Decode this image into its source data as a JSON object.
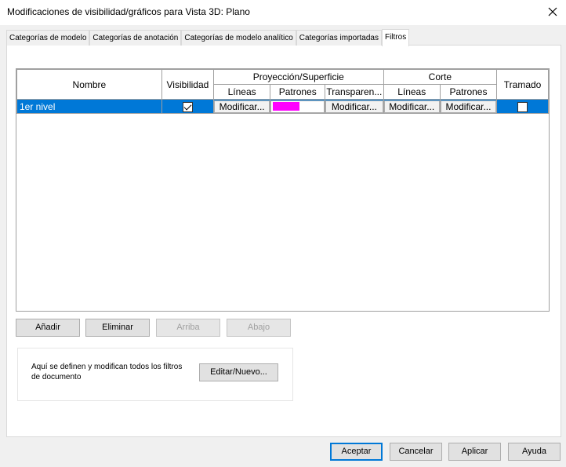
{
  "window": {
    "title": "Modificaciones de visibilidad/gráficos para Vista 3D: Plano"
  },
  "tabs": [
    {
      "label": "Categorías de modelo"
    },
    {
      "label": "Categorías de anotación"
    },
    {
      "label": "Categorías de modelo analítico"
    },
    {
      "label": "Categorías importadas"
    },
    {
      "label": "Filtros",
      "active": true
    }
  ],
  "grid": {
    "headers": {
      "nombre": "Nombre",
      "visibilidad": "Visibilidad",
      "proyeccion": "Proyección/Superficie",
      "corte": "Corte",
      "tramado": "Tramado",
      "lineas": "Líneas",
      "patrones": "Patrones",
      "transparencia": "Transparen...",
      "corte_lineas": "Líneas",
      "corte_patrones": "Patrones"
    },
    "rows": [
      {
        "nombre": "1er nivel",
        "visibilidad_checked": true,
        "proy_lineas": "Modificar...",
        "proy_patrones_color": "#ff00ff",
        "transparencia": "Modificar...",
        "corte_lineas": "Modificar...",
        "corte_patrones": "Modificar...",
        "tramado_checked": false,
        "selected": true
      }
    ]
  },
  "filter_buttons": {
    "anadir": "Añadir",
    "eliminar": "Eliminar",
    "arriba": "Arriba",
    "abajo": "Abajo"
  },
  "document_filters": {
    "description": "Aquí se definen y modifican todos los filtros de documento",
    "edit_button": "Editar/Nuevo..."
  },
  "footer": {
    "aceptar": "Aceptar",
    "cancelar": "Cancelar",
    "aplicar": "Aplicar",
    "ayuda": "Ayuda"
  },
  "colors": {
    "selection": "#0078d7",
    "pattern_swatch": "#ff00ff"
  }
}
